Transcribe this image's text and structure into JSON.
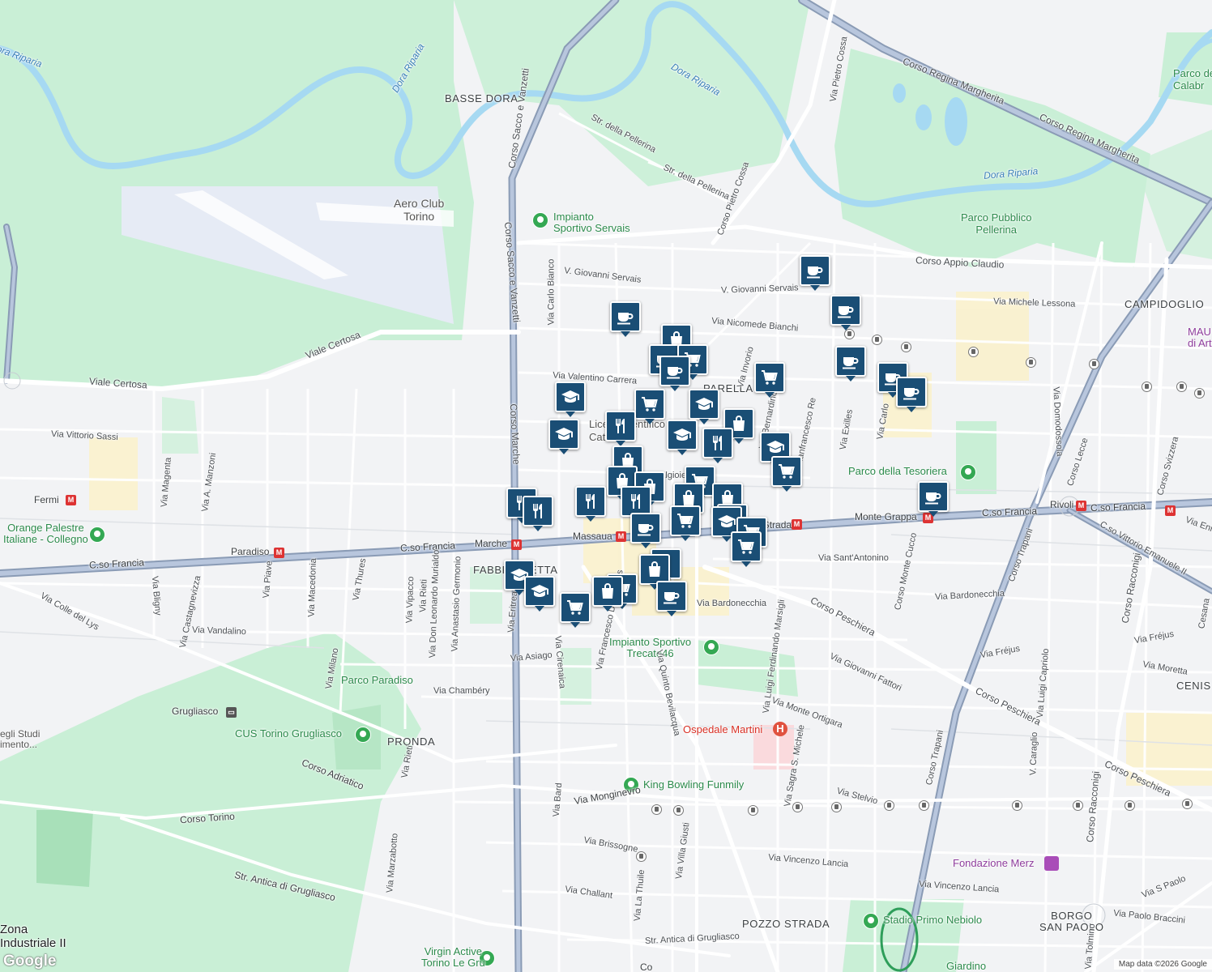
{
  "map": {
    "attribution": "Map data ©2026 Google",
    "logo": "Google",
    "district_labels": [
      "BASSE DORA",
      "PARELLA",
      "FABBRICHETTA",
      "CAMPIDOGLIO",
      "PRONDA",
      "POZZO STRADA",
      "CENIS",
      "BORGO\nSAN PAOLO",
      "Zona\nIndustriale II"
    ],
    "water_labels": [
      "Dora Riparia",
      "Dora Riparia",
      "Dora Riparia"
    ],
    "park_labels": [
      "Parco della Tesoriera",
      "Parco Paradiso",
      "Parco Pubblico\nPellerina",
      "Parco de\nCalabr",
      "Giardino"
    ],
    "poi_labels": [
      "Impianto\nSportivo Servais",
      "Orange Palestre\nItaliane - Collegno",
      "CUS Torino Grugliasco",
      "Impianto Sportivo\nTrecate46",
      "King Bowling Funmily",
      "Stadio Primo Nebiolo",
      "Virgin Active\nTorino Le Gru",
      "Liceo Scientifico\nCattaneo",
      "egli Studi\nimento..."
    ],
    "hospital_label": "Ospedale Martini",
    "museum_labels": [
      "Fondazione Merz",
      "MAU\ndi Art"
    ],
    "airfield_label": "Aero Club\nTorino",
    "metro_labels": [
      "Fermi",
      "Paradiso",
      "Marche",
      "Massaua",
      "Pozzo Strada",
      "Monte Grappa",
      "Rivoli",
      "Grugliasco"
    ],
    "street_labels": [
      "Corso Sacco e Vanzetti",
      "Corso Sacco e Vanzetti",
      "Corso Marche",
      "Via Pietro Cossa",
      "Corso Pietro Cossa",
      "Corso Regina Margherita",
      "Corso Regina Margherita",
      "Corso Appio Claudio",
      "Str. della Pellerina",
      "Str. della Pellerina",
      "Viale Certosa",
      "Viale Certosa",
      "V. Giovanni Servais",
      "V. Giovanni Servais",
      "Via Nicomede Bianchi",
      "Via Michele Lessona",
      "Via Valentino Carrera",
      "Via Vittorio Sassi",
      "Via Carlo Bianco",
      "Via Valgioie",
      "C.so Francia",
      "C.so Francia",
      "C.so Francia",
      "C.so Francia",
      "Corso Lecce",
      "Corso Svizzera",
      "C.so Vittorio Emanuele II",
      "Corso Trapani",
      "Corso Trapani",
      "Corso Peschiera",
      "Corso Peschiera",
      "Corso Peschiera",
      "Via Bardonecchia",
      "Via Bardonecchia",
      "Via Sant'Antonino",
      "Via Giovanni Fattori",
      "Via Monte Ortigara",
      "Via Luigi Ferdinando Marsigli",
      "Via Sagra S. Michele",
      "Via Exilles",
      "Via Carlo",
      "Via Domodossola",
      "Via Fréjus",
      "Via Fréjus",
      "Via Moretta",
      "Via Luigi Capriolo",
      "V. Caraglio",
      "Corso Racconigi",
      "Corso Racconigi",
      "Via Enrico",
      "Corso Monte Cucco",
      "Via Stelvio",
      "Via Vincenzo Lancia",
      "Via Vincenzo Lancia",
      "Via S Paolo",
      "Via Paolo Braccini",
      "Via Tolmino",
      "Via Monginevro",
      "Via Brissogne",
      "Via Challant",
      "Via La Thuile",
      "Via Villa Giusti",
      "Via Bard",
      "Via Quinto Bevilacqua",
      "Via Francesco De Sanctis",
      "Via Cirenaica",
      "Via Asiago",
      "Via Chambéry",
      "Via Vandalino",
      "Via Colle del Lys",
      "Via Castagnevizza",
      "Via Magenta",
      "Via A. Manzoni",
      "Via Bligny",
      "Via Piave",
      "Via Macedonia",
      "Via Thures",
      "Via Milano",
      "Via Vipacco",
      "Via Rieti",
      "Via Rieti",
      "Via Don Leonardo Murialdo",
      "Via Anastasio Germonio",
      "Via Eritrea",
      "Corso Adriatico",
      "Corso Torino",
      "Str. Antica di Grugliasco",
      "Str. Antica di Grugliasco",
      "Via Marzabotto",
      "Via Invorio",
      "Via Gianfrancesco Re",
      "Via Bernardino Telesio",
      "Cesana",
      "Co"
    ],
    "markers": [
      {
        "type": "cafe"
      },
      {
        "type": "cafe"
      },
      {
        "type": "cafe"
      },
      {
        "type": "cafe"
      },
      {
        "type": "cafe"
      },
      {
        "type": "cafe"
      },
      {
        "type": "cafe"
      },
      {
        "type": "cafe"
      },
      {
        "type": "cafe"
      },
      {
        "type": "cafe"
      },
      {
        "type": "cafe"
      },
      {
        "type": "shop"
      },
      {
        "type": "shop"
      },
      {
        "type": "shop"
      },
      {
        "type": "shop"
      },
      {
        "type": "shop"
      },
      {
        "type": "shop"
      },
      {
        "type": "shop"
      },
      {
        "type": "shop"
      },
      {
        "type": "shop"
      },
      {
        "type": "grocery"
      },
      {
        "type": "grocery"
      },
      {
        "type": "grocery"
      },
      {
        "type": "grocery"
      },
      {
        "type": "grocery"
      },
      {
        "type": "grocery"
      },
      {
        "type": "grocery"
      },
      {
        "type": "grocery"
      },
      {
        "type": "grocery"
      },
      {
        "type": "grocery"
      },
      {
        "type": "restaurant"
      },
      {
        "type": "restaurant"
      },
      {
        "type": "restaurant"
      },
      {
        "type": "restaurant"
      },
      {
        "type": "restaurant"
      },
      {
        "type": "restaurant"
      },
      {
        "type": "restaurant"
      },
      {
        "type": "school"
      },
      {
        "type": "school"
      },
      {
        "type": "school"
      },
      {
        "type": "school"
      },
      {
        "type": "school"
      },
      {
        "type": "school"
      },
      {
        "type": "school"
      },
      {
        "type": "school"
      },
      {
        "type": "school"
      }
    ],
    "colors": {
      "land": "#f2f3f5",
      "park": "#c9efd6",
      "water": "#a6d9f2",
      "highway": "#8a9bb5",
      "road": "#ffffff",
      "marker": "#1a4e75",
      "metro": "#dd3333",
      "hospital_area": "#fadadd",
      "airfield": "#e6ebf5"
    }
  }
}
